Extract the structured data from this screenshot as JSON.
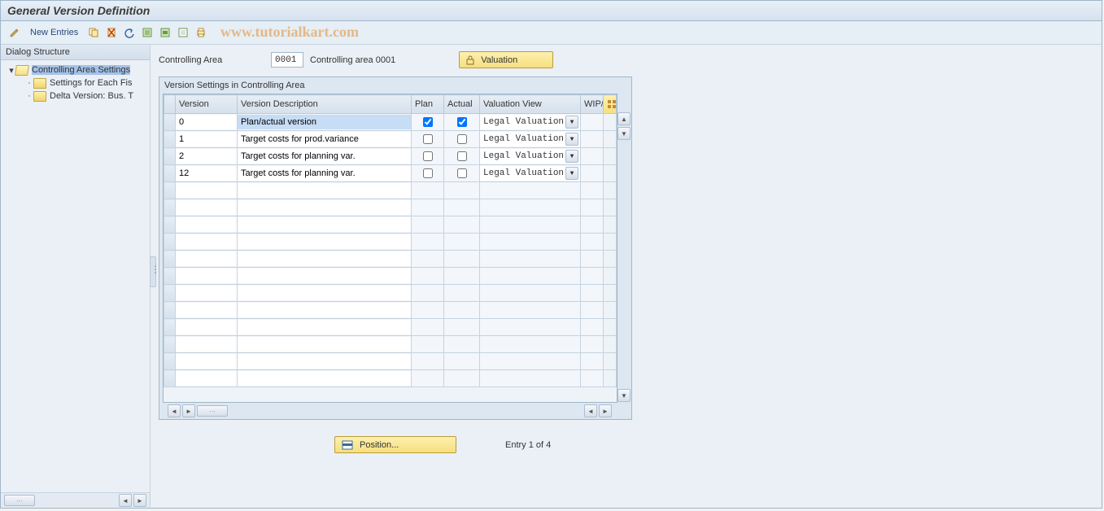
{
  "title": "General Version Definition",
  "watermark": "www.tutorialkart.com",
  "toolbar": {
    "new_entries_label": "New Entries"
  },
  "sidebar": {
    "header": "Dialog Structure",
    "nodes": [
      {
        "label": "Controlling Area Settings",
        "icon": "open",
        "level": 1,
        "expanded": true,
        "selected": true
      },
      {
        "label": "Settings for Each Fis",
        "icon": "closed",
        "level": 2,
        "expanded": false,
        "selected": false
      },
      {
        "label": "Delta Version: Bus. T",
        "icon": "closed",
        "level": 2,
        "expanded": false,
        "selected": false
      }
    ]
  },
  "header_fields": {
    "controlling_area_label": "Controlling Area",
    "controlling_area_code": "0001",
    "controlling_area_text": "Controlling area 0001",
    "valuation_button": "Valuation"
  },
  "table": {
    "group_title": "Version Settings in Controlling Area",
    "columns": {
      "version": "Version",
      "description": "Version Description",
      "plan": "Plan",
      "actual": "Actual",
      "valuation_view": "Valuation View",
      "wip": "WIP/"
    },
    "valuation_option": "Legal Valuation",
    "rows": [
      {
        "version": "0",
        "description": "Plan/actual version",
        "plan": true,
        "actual": true,
        "valuation": "Legal Valuation",
        "highlight": true
      },
      {
        "version": "1",
        "description": "Target costs for prod.variance",
        "plan": false,
        "actual": false,
        "valuation": "Legal Valuation",
        "highlight": false
      },
      {
        "version": "2",
        "description": "Target costs for planning var.",
        "plan": false,
        "actual": false,
        "valuation": "Legal Valuation",
        "highlight": false
      },
      {
        "version": "12",
        "description": "Target costs for planning var.",
        "plan": false,
        "actual": false,
        "valuation": "Legal Valuation",
        "highlight": false
      }
    ],
    "empty_rows": 12
  },
  "footer": {
    "position_button": "Position...",
    "entry_info": "Entry 1 of 4"
  }
}
